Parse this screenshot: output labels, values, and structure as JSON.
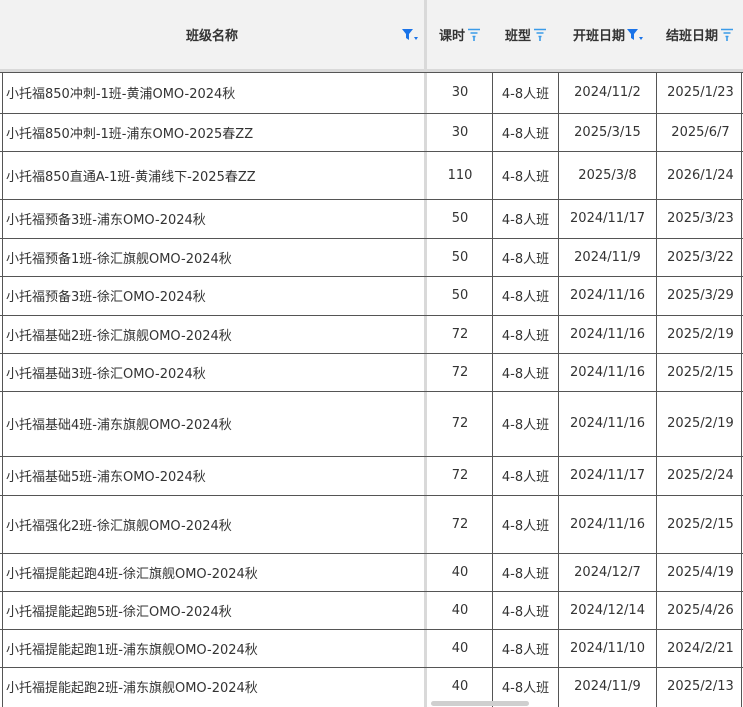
{
  "columns": [
    {
      "label": "班级名称",
      "filter_active": true
    },
    {
      "label": "课时",
      "filter_active": false
    },
    {
      "label": "班型",
      "filter_active": false
    },
    {
      "label": "开班日期",
      "filter_active": true
    },
    {
      "label": "结班日期",
      "filter_active": false
    }
  ],
  "rows": [
    {
      "name": "小托福850冲刺-1班-黄浦OMO-2024秋",
      "hours": "30",
      "type": "4-8人班",
      "start": "2024/11/2",
      "end": "2025/1/23"
    },
    {
      "name": "小托福850冲刺-1班-浦东OMO-2025春ZZ",
      "hours": "30",
      "type": "4-8人班",
      "start": "2025/3/15",
      "end": "2025/6/7"
    },
    {
      "name": "小托福850直通A-1班-黄浦线下-2025春ZZ",
      "hours": "110",
      "type": "4-8人班",
      "start": "2025/3/8",
      "end": "2026/1/24"
    },
    {
      "name": "小托福预备3班-浦东OMO-2024秋",
      "hours": "50",
      "type": "4-8人班",
      "start": "2024/11/17",
      "end": "2025/3/23"
    },
    {
      "name": "小托福预备1班-徐汇旗舰OMO-2024秋",
      "hours": "50",
      "type": "4-8人班",
      "start": "2024/11/9",
      "end": "2025/3/22"
    },
    {
      "name": "小托福预备3班-徐汇OMO-2024秋",
      "hours": "50",
      "type": "4-8人班",
      "start": "2024/11/16",
      "end": "2025/3/29"
    },
    {
      "name": "小托福基础2班-徐汇旗舰OMO-2024秋",
      "hours": "72",
      "type": "4-8人班",
      "start": "2024/11/16",
      "end": "2025/2/19"
    },
    {
      "name": "小托福基础3班-徐汇OMO-2024秋",
      "hours": "72",
      "type": "4-8人班",
      "start": "2024/11/16",
      "end": "2025/2/15"
    },
    {
      "name": "小托福基础4班-浦东旗舰OMO-2024秋",
      "hours": "72",
      "type": "4-8人班",
      "start": "2024/11/16",
      "end": "2025/2/19"
    },
    {
      "name": "小托福基础5班-浦东OMO-2024秋",
      "hours": "72",
      "type": "4-8人班",
      "start": "2024/11/17",
      "end": "2025/2/24"
    },
    {
      "name": "小托福强化2班-徐汇旗舰OMO-2024秋",
      "hours": "72",
      "type": "4-8人班",
      "start": "2024/11/16",
      "end": "2025/2/15"
    },
    {
      "name": "小托福提能起跑4班-徐汇旗舰OMO-2024秋",
      "hours": "40",
      "type": "4-8人班",
      "start": "2024/12/7",
      "end": "2025/4/19"
    },
    {
      "name": "小托福提能起跑5班-徐汇OMO-2024秋",
      "hours": "40",
      "type": "4-8人班",
      "start": "2024/12/14",
      "end": "2025/4/26"
    },
    {
      "name": "小托福提能起跑1班-浦东旗舰OMO-2024秋",
      "hours": "40",
      "type": "4-8人班",
      "start": "2024/11/10",
      "end": "2024/2/21"
    },
    {
      "name": "小托福提能起跑2班-浦东旗舰OMO-2024秋",
      "hours": "40",
      "type": "4-8人班",
      "start": "2024/11/9",
      "end": "2025/2/13"
    }
  ],
  "colors": {
    "filter_active": "#1a73e8",
    "filter_idle": "#3b9be8"
  }
}
